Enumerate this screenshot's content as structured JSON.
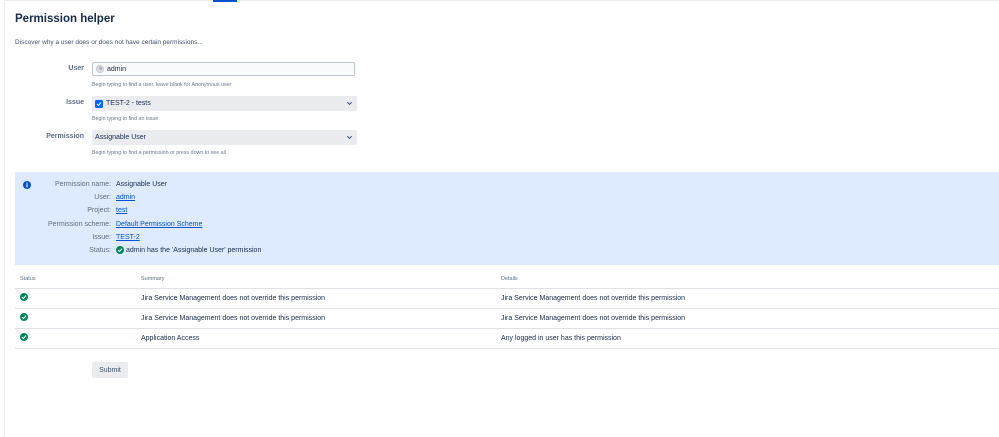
{
  "page": {
    "title": "Permission helper",
    "description": "Discover why a user does or does not have certain permissions..."
  },
  "form": {
    "user": {
      "label": "User",
      "value": "admin",
      "hint": "Begin typing to find a user, leave blank for Anonymous user"
    },
    "issue": {
      "label": "Issue",
      "value": "TEST-2 - tests",
      "hint": "Begin typing to find an issue"
    },
    "permission": {
      "label": "Permission",
      "value": "Assignable User",
      "hint": "Begin typing to find a permission or press down to see all"
    }
  },
  "info": {
    "permission_name_label": "Permission name:",
    "permission_name": "Assignable User",
    "user_label": "User:",
    "user": "admin",
    "project_label": "Project:",
    "project": "test",
    "scheme_label": "Permission scheme:",
    "scheme": "Default Permission Scheme",
    "issue_label": "Issue:",
    "issue": "TEST-2",
    "status_label": "Status:",
    "status": "admin has the 'Assignable User' permission"
  },
  "table": {
    "headers": {
      "status": "Status",
      "summary": "Summary",
      "details": "Details"
    },
    "rows": [
      {
        "summary": "Jira Service Management does not override this permission",
        "details": "Jira Service Management does not override this permission"
      },
      {
        "summary": "Jira Service Management does not override this permission",
        "details": "Jira Service Management does not override this permission"
      },
      {
        "summary": "Application Access",
        "details": "Any logged in user has this permission"
      }
    ]
  },
  "actions": {
    "submit_label": "Submit"
  },
  "icons": {
    "status_ok": "check-circle-icon",
    "info": "info-circle-icon",
    "user_avatar": "avatar-icon",
    "issue_type": "task-checkbox-icon",
    "dropdown": "chevron-down-icon"
  },
  "colors": {
    "accent": "#0052cc",
    "success": "#00875a",
    "info_panel": "#deebff",
    "issue_icon": "#0065ff"
  }
}
